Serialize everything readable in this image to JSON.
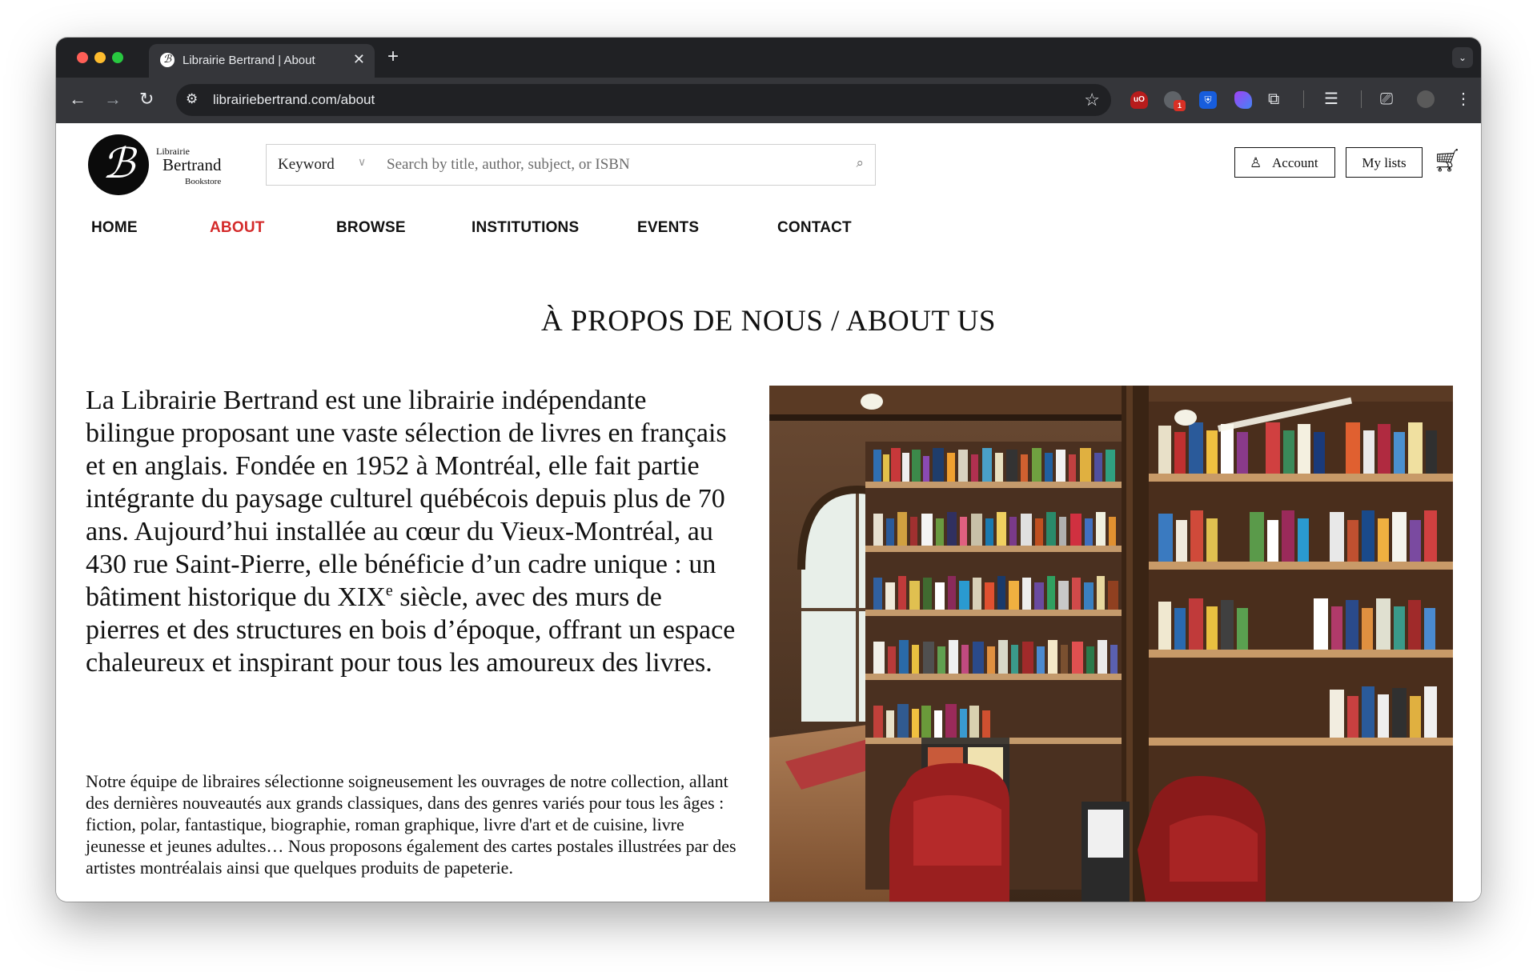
{
  "browser": {
    "tab_title": "Librairie Bertrand | About",
    "tab_close": "✕",
    "new_tab": "+",
    "url": "librairiebertrand.com/about",
    "ublock_label": "uO",
    "ext_badge": "1"
  },
  "header": {
    "logo_small_top": "Librairie",
    "logo_name": "Bertrand",
    "logo_small_bottom": "Bookstore",
    "search_type": "Keyword",
    "search_placeholder": "Search by title, author, subject, or ISBN",
    "account_label": "Account",
    "lists_label": "My lists"
  },
  "nav": {
    "items": [
      {
        "label": "HOME"
      },
      {
        "label": "ABOUT"
      },
      {
        "label": "BROWSE"
      },
      {
        "label": "INSTITUTIONS"
      },
      {
        "label": "EVENTS"
      },
      {
        "label": "CONTACT"
      }
    ],
    "active": "ABOUT"
  },
  "content": {
    "title": "À PROPOS DE NOUS / ABOUT US",
    "intro_before_sup": "La Librairie Bertrand est une librairie indépendante bilingue proposant une vaste sélection de livres en français et en anglais. Fondée en 1952 à Montréal, elle fait partie intégrante du paysage culturel québécois depuis plus de 70 ans. Aujourd’hui installée au cœur du Vieux-Montréal, au 430 rue Saint-Pierre, elle bénéficie d’un cadre unique : un bâtiment historique du XIX",
    "intro_sup": "e",
    "intro_after_sup": " siècle, avec des murs de pierres et des structures en bois d’époque, offrant un espace chaleureux et inspirant pour tous les amoureux des livres.",
    "body": "Notre équipe de libraires sélectionne soigneusement les ouvrages de notre collection, allant des dernières nouveautés aux grands classiques, dans des genres variés pour tous les âges : fiction, polar, fantastique, biographie, roman graphique, livre d'art et de cuisine, livre jeunesse et jeunes adultes… Nous proposons également des cartes postales illustrées par des artistes montréalais ainsi que quelques produits de papeterie."
  },
  "colors": {
    "nav_active": "#d42a2a",
    "chrome_dark": "#202124",
    "chrome_toolbar": "#35363a"
  }
}
